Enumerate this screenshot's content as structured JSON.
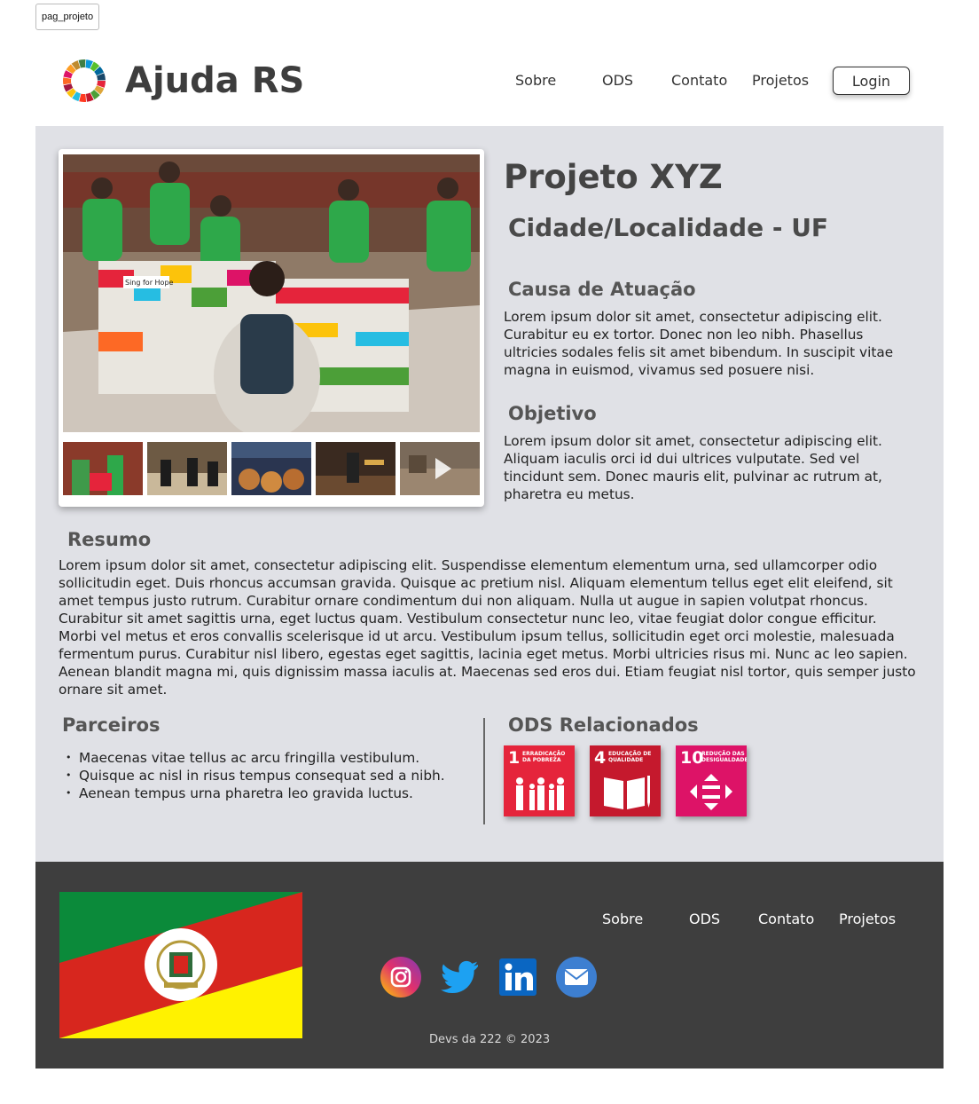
{
  "frame_label": "pag_projeto",
  "header": {
    "brand": "Ajuda RS",
    "nav": [
      "Sobre",
      "ODS",
      "Contato",
      "Projetos"
    ],
    "login_label": "Login"
  },
  "project": {
    "title": "Projeto XYZ",
    "location": "Cidade/Localidade - UF",
    "cause_heading": "Causa de Atuação",
    "cause_text": "Lorem ipsum dolor sit amet, consectetur adipiscing elit. Curabitur eu ex tortor. Donec non leo nibh. Phasellus ultricies sodales felis sit amet bibendum. In suscipit vitae magna in euismod, vivamus sed posuere nisi.",
    "objective_heading": "Objetivo",
    "objective_text": "Lorem ipsum dolor sit amet, consectetur adipiscing elit. Aliquam iaculis orci id dui ultrices vulputate. Sed vel tincidunt sem. Donec mauris elit, pulvinar ac rutrum at, pharetra eu metus.",
    "summary_heading": "Resumo",
    "summary_text": "Lorem ipsum dolor sit amet, consectetur adipiscing elit. Suspendisse elementum elementum urna, sed ullamcorper odio sollicitudin eget. Duis rhoncus accumsan gravida. Quisque ac pretium nisl. Aliquam elementum tellus eget elit eleifend, sit amet tempus justo rutrum. Curabitur ornare condimentum dui non aliquam. Nulla ut augue in sapien volutpat rhoncus. Curabitur sit amet sagittis urna, eget luctus quam. Vestibulum consectetur nunc leo, vitae feugiat dolor congue efficitur. Morbi vel metus et eros convallis scelerisque id ut arcu. Vestibulum ipsum tellus, sollicitudin eget orci molestie, malesuada fermentum purus. Curabitur nisl libero, egestas eget sagittis, lacinia eget metus. Morbi ultricies risus mi. Nunc ac leo sapien. Aenean blandit magna mi, quis dignissim massa iaculis at. Maecenas sed eros dui. Etiam feugiat nisl tortor, quis semper justo ornare sit amet."
  },
  "gallery": {
    "main_photo_text": "Sing for Hope"
  },
  "partners": {
    "heading": "Parceiros",
    "items": [
      "Maecenas vitae tellus ac arcu fringilla vestibulum.",
      "Quisque ac nisl in risus tempus consequat sed a nibh.",
      "Aenean tempus urna pharetra leo gravida luctus."
    ]
  },
  "ods": {
    "heading": "ODS Relacionados",
    "cards": [
      {
        "number": "1",
        "label": "ERRADICAÇÃO DA POBREZA",
        "color": "#e5243b"
      },
      {
        "number": "4",
        "label": "EDUCAÇÃO DE QUALIDADE",
        "color": "#c5192d"
      },
      {
        "number": "10",
        "label": "REDUÇÃO DAS DESIGUALDADES",
        "color": "#dd1367"
      }
    ]
  },
  "footer": {
    "nav": [
      "Sobre",
      "ODS",
      "Contato",
      "Projetos"
    ],
    "social": [
      "instagram-icon",
      "twitter-icon",
      "linkedin-icon",
      "email-icon"
    ],
    "copyright": "Devs da 222 © 2023"
  },
  "colors": {
    "main_bg": "#e0e1e6",
    "footer_bg": "#3e3e3e",
    "flag_green": "#0b8a3a",
    "flag_red": "#d7261e",
    "flag_yellow": "#fff200"
  }
}
